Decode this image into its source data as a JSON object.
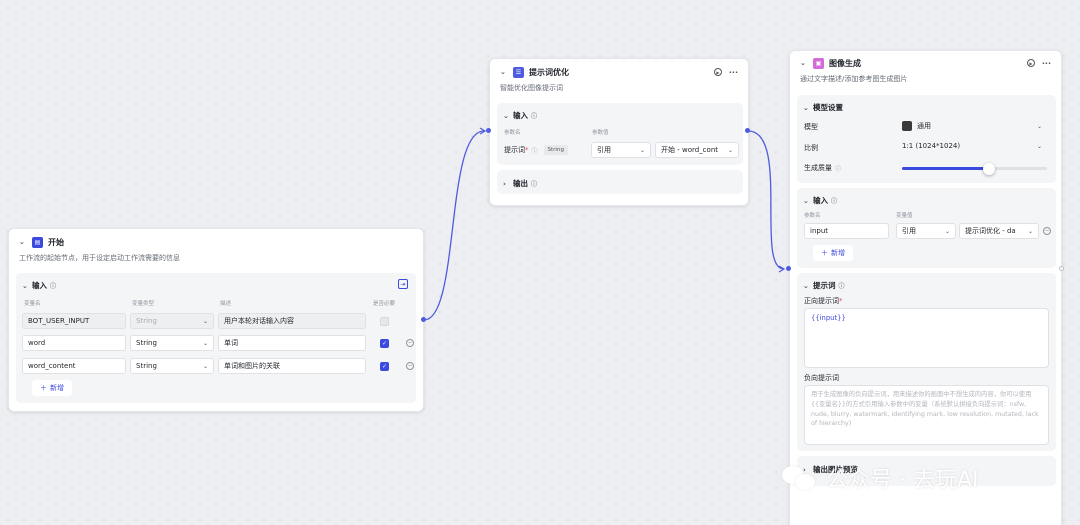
{
  "start_node": {
    "title": "开始",
    "desc": "工作流的起始节点，用于设定启动工作流需要的信息",
    "input_section": "输入",
    "columns": {
      "name": "变量名",
      "type": "变量类型",
      "desc": "描述",
      "required": "是否必要"
    },
    "rows": [
      {
        "name": "BOT_USER_INPUT",
        "type": "String",
        "desc": "用户本轮对话输入内容",
        "required": false,
        "locked": true
      },
      {
        "name": "word",
        "type": "String",
        "desc": "单词",
        "required": true,
        "locked": false
      },
      {
        "name": "word_content",
        "type": "String",
        "desc": "单词和图片的关联",
        "required": true,
        "locked": false
      }
    ],
    "add_label": "新增"
  },
  "prompt_node": {
    "title": "提示词优化",
    "desc": "智能优化图像提示词",
    "input_section": "输入",
    "columns": {
      "param": "参数名",
      "value": "参数值"
    },
    "param_label": "提示词",
    "param_type": "String",
    "ref_select": "引用",
    "value_select": "开始 - word_cont",
    "output_section": "输出"
  },
  "image_node": {
    "title": "图像生成",
    "desc": "通过文字描述/添加参考图生成图片",
    "model_section": "模型设置",
    "model_label": "模型",
    "model_value": "通用",
    "ratio_label": "比例",
    "ratio_value": "1:1 (1024*1024)",
    "quality_label": "生成质量",
    "quality_level": 0.6,
    "input_section": "输入",
    "columns": {
      "name": "参数名",
      "value": "变量值"
    },
    "input_name": "input",
    "ref_select": "引用",
    "value_select": "提示词优化 - da",
    "add_label": "新增",
    "prompt_section": "提示词",
    "positive_label": "正向提示词",
    "positive_value": "{{input}}",
    "negative_label": "负向提示词",
    "negative_placeholder": "用于生成图像的负向提示词，用来描述你的画面中不想生成的内容，你可以使用{{变量名}}的方式引用输入参数中的变量（系统默认拼接负向提示词：nsfw, nude, blurry, watermark, identifying mark, low resolution, mutated, lack of hierarchy)",
    "preview_section": "输出图片预览"
  },
  "watermark": {
    "text": "公众号 · 去玩AI"
  },
  "colors": {
    "accent": "#3b49df",
    "edge": "#4e5bde",
    "start_icon": "#3b49df",
    "prompt_icon": "#4e5bde",
    "image_icon": "#d46bd9"
  }
}
